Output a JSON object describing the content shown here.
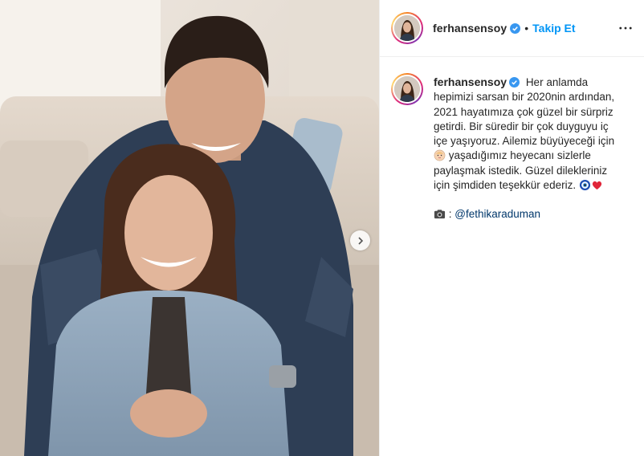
{
  "post": {
    "username": "ferhansensoy",
    "follow_label": "Takip Et",
    "separator": "•",
    "caption": {
      "line1": "Her anlamda",
      "line2": "hepimizi sarsan bir 2020nin ardından,",
      "line3": "2021 hayatımıza çok güzel bir sürpriz",
      "line4": "getirdi. Bir süredir bir çok duyguyu iç",
      "line5": "içe yaşıyoruz. Ailemiz büyüyeceği için",
      "line6": "yaşadığımız heyecanı sizlerle",
      "line7": "paylaşmak istedik. Güzel dilekleriniz",
      "line8": "için şimdiden teşekkür ederiz."
    },
    "credit": {
      "separator": ":",
      "mention": "@fethikaraduman"
    }
  },
  "colors": {
    "accent": "#0095f6",
    "verified": "#3897f0",
    "mention": "#00376b",
    "text": "#262626",
    "border": "#efefef"
  },
  "icons": {
    "verified": "verified-badge-icon",
    "more": "more-options-icon",
    "next": "chevron-right-icon",
    "baby": "baby-emoji",
    "evil_eye": "nazar-emoji",
    "heart": "red-heart-emoji",
    "camera": "camera-emoji"
  }
}
